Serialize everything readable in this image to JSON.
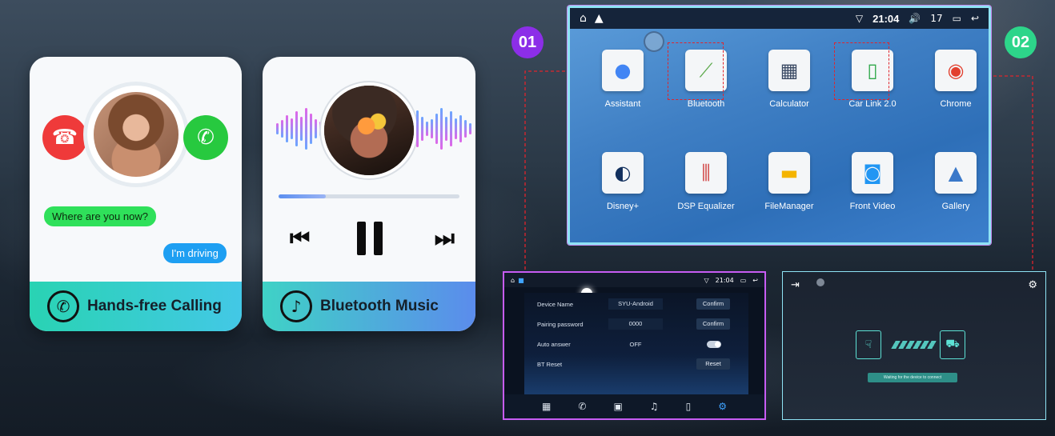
{
  "calling_card": {
    "incoming_message": "Where are you now?",
    "reply_message": "I'm driving",
    "footer_label": "Hands-free Calling",
    "decline_icon": "phone-hangup-icon",
    "accept_icon": "phone-accept-icon",
    "footer_icon": "phone-circle-icon"
  },
  "music_card": {
    "footer_label": "Bluetooth Music",
    "footer_icon": "music-note-icon",
    "progress": 0.26,
    "controls": [
      "previous-icon",
      "pause-icon",
      "next-icon"
    ]
  },
  "badges": {
    "step_one": "01",
    "step_two": "02"
  },
  "launcher": {
    "status": {
      "time": "21:04",
      "volume": "17"
    },
    "apps": [
      {
        "label": "Assistant",
        "icon": "assistant-icon"
      },
      {
        "label": "Bluetooth",
        "icon": "bluetooth-app-icon"
      },
      {
        "label": "Calculator",
        "icon": "calculator-icon"
      },
      {
        "label": "Car Link 2.0",
        "icon": "car-link-icon"
      },
      {
        "label": "Chrome",
        "icon": "chrome-icon"
      },
      {
        "label": "Disney+",
        "icon": "disney-plus-icon"
      },
      {
        "label": "DSP Equalizer",
        "icon": "equalizer-icon"
      },
      {
        "label": "FileManager",
        "icon": "folder-icon"
      },
      {
        "label": "Front Video",
        "icon": "camera-icon"
      },
      {
        "label": "Gallery",
        "icon": "gallery-icon"
      }
    ]
  },
  "bt_settings": {
    "status_time": "21:04",
    "rows": [
      {
        "label": "Device Name",
        "value": "SYU-Android",
        "button": "Confirm"
      },
      {
        "label": "Pairing password",
        "value": "0000",
        "button": "Confirm"
      },
      {
        "label": "Auto answer",
        "value": "OFF",
        "toggle": true
      },
      {
        "label": "BT Reset",
        "value": "",
        "button": "Reset"
      }
    ]
  },
  "car_link": {
    "status_text": "Waiting for the device to connect"
  },
  "colors": {
    "accept_green": "#27c93f",
    "decline_red": "#ef3a3a",
    "highlight_red": "#e0242c",
    "badge_purple": "#8c2ee8",
    "badge_green": "#2dd58a"
  }
}
